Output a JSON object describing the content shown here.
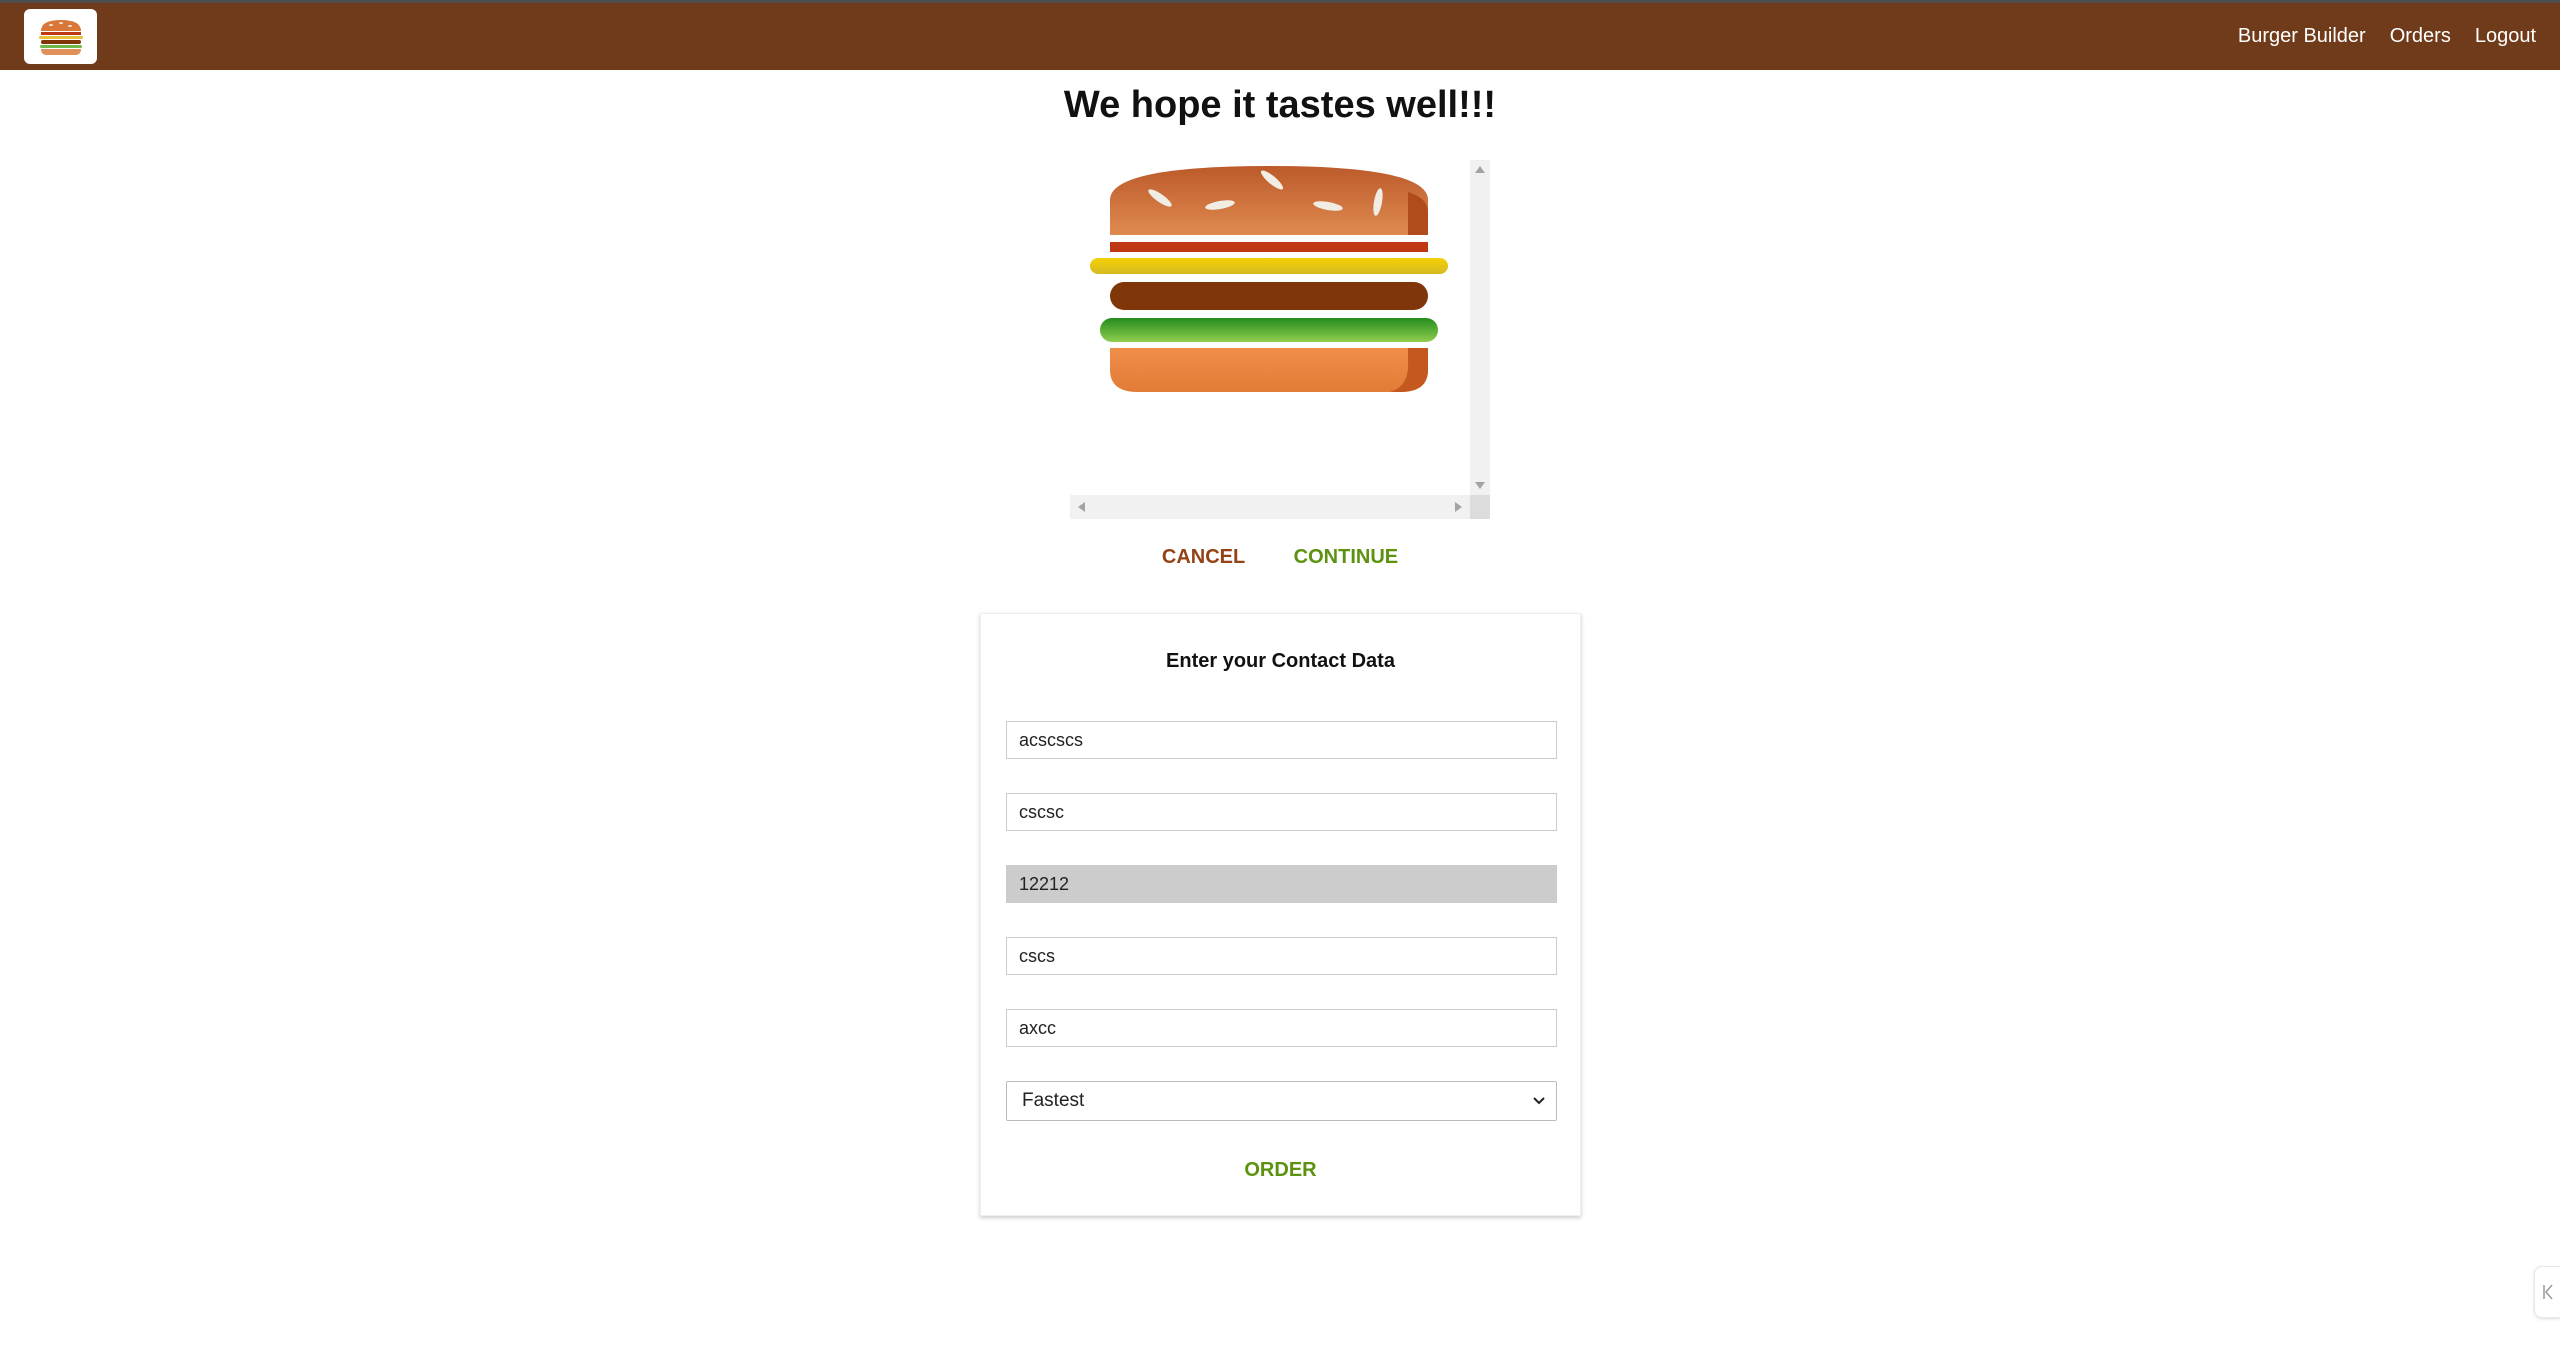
{
  "toolbar": {
    "logo_icon": "burger-logo-icon",
    "nav": [
      {
        "label": "Burger Builder"
      },
      {
        "label": "Orders"
      },
      {
        "label": "Logout"
      }
    ]
  },
  "checkout": {
    "title": "We hope it tastes well!!!",
    "ingredients": [
      "bread-top",
      "bacon",
      "cheese",
      "meat",
      "salad",
      "bread-bottom"
    ],
    "cancel_label": "CANCEL",
    "continue_label": "CONTINUE"
  },
  "contact": {
    "title": "Enter your Contact Data",
    "fields": [
      {
        "value": "acscscs"
      },
      {
        "value": "cscsc"
      },
      {
        "value": "12212"
      },
      {
        "value": "cscs"
      },
      {
        "value": "axcc"
      }
    ],
    "delivery_method": "Fastest",
    "order_label": "ORDER"
  },
  "colors": {
    "toolbar": "#703b1a",
    "cancel": "#944317",
    "continue": "#5c9210"
  }
}
